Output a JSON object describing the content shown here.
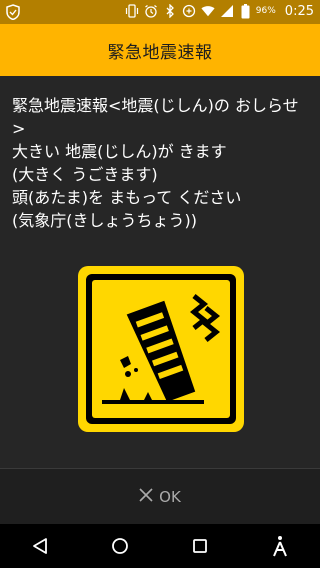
{
  "status_bar": {
    "left_icon": "shield-icon",
    "icons": [
      "vibrate-icon",
      "alarm-icon",
      "bluetooth-icon",
      "data-saver-icon",
      "wifi-icon",
      "signal-icon",
      "battery-icon"
    ],
    "battery": "96%",
    "time": "0:25",
    "background_color": "#b37f00"
  },
  "header": {
    "title": "緊急地震速報",
    "background_color": "#ffb400"
  },
  "message": {
    "text": "緊急地震速報<地震(じしん)の おしらせ>\n大きい 地震(じしん)が きます\n(大きく うごきます)\n頭(あたま)を まもって ください\n(気象庁(きしょうちょう))"
  },
  "icon": {
    "name": "earthquake-building-icon",
    "color": "#ffd700"
  },
  "ok_button": {
    "label": "OK",
    "icon": "close-icon"
  },
  "nav": {
    "back": "back-icon",
    "home": "home-icon",
    "recents": "recents-icon",
    "accessibility": "accessibility-icon"
  }
}
